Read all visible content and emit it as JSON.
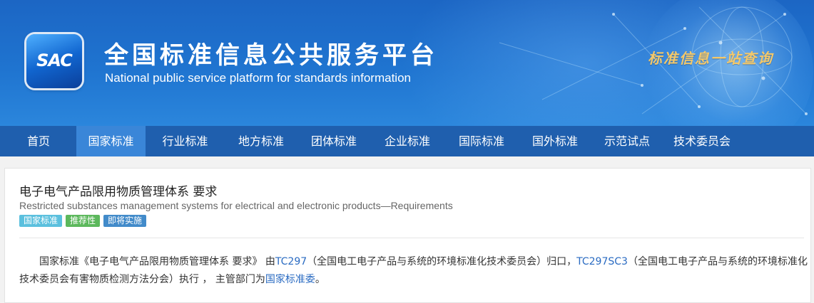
{
  "header": {
    "logo_text": "SAC",
    "title_cn": "全国标准信息公共服务平台",
    "title_en": "National public service platform  for standards information",
    "slogan": "标准信息一站查询"
  },
  "nav": {
    "items": [
      {
        "label": "首页"
      },
      {
        "label": "国家标准"
      },
      {
        "label": "行业标准"
      },
      {
        "label": "地方标准"
      },
      {
        "label": "团体标准"
      },
      {
        "label": "企业标准"
      },
      {
        "label": "国际标准"
      },
      {
        "label": "国外标准"
      },
      {
        "label": "示范试点"
      },
      {
        "label": "技术委员会"
      }
    ],
    "active": "国家标准"
  },
  "standard": {
    "title_cn": "电子电气产品限用物质管理体系 要求",
    "title_en": "Restricted substances management systems for electrical and electronic products—Requirements",
    "badges": [
      {
        "label": "国家标准",
        "color": "#5bc0de"
      },
      {
        "label": "推荐性",
        "color": "#5cb85c"
      },
      {
        "label": "即将实施",
        "color": "#428bca"
      }
    ],
    "description": {
      "part1": "国家标准《电子电气产品限用物质管理体系 要求》 由",
      "link1": "TC297",
      "part2": "（全国电工电子产品与系统的环境标准化技术委员会）归口，",
      "link2": "TC297SC3",
      "part3": "（全国电工电子产品与系统的环境标准化技术委员会有害物质检测方法分会）执行 ， 主管部门为",
      "link3": "国家标准委",
      "part4": "。"
    }
  },
  "colors": {
    "banner": "#1f74d0",
    "nav": "#1f5fae",
    "nav_active": "#3a86d8",
    "link": "#2a6bc2",
    "slogan": "#f3c86b"
  }
}
